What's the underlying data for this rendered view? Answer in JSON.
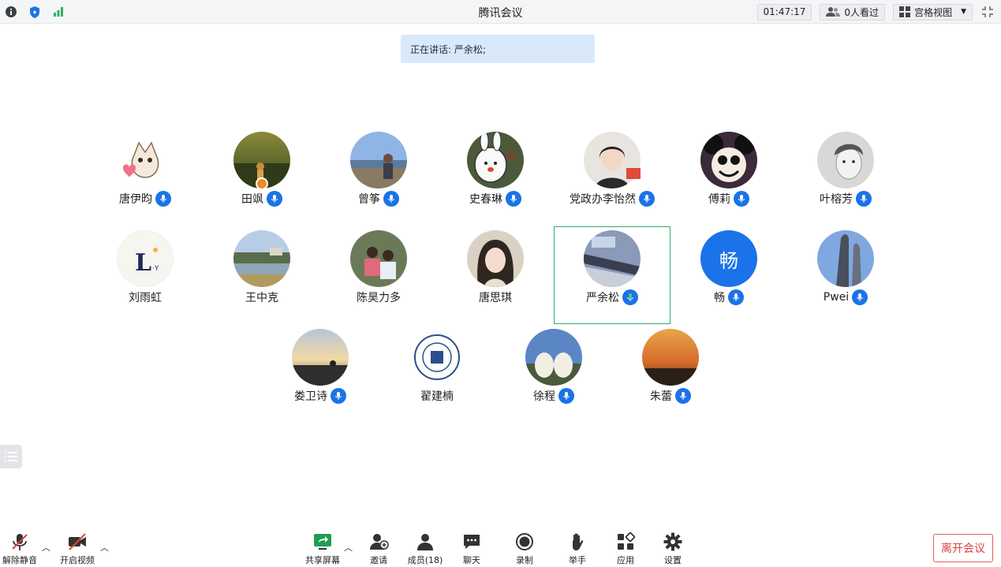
{
  "titlebar": {
    "title": "腾讯会议",
    "timer": "01:47:17",
    "viewers": "0人看过",
    "view_mode": "宫格视图"
  },
  "speaking_banner": "正在讲话: 严余松;",
  "participants": [
    {
      "name": "唐伊昀",
      "mic_icon": "mic-icon"
    },
    {
      "name": "田飒",
      "mic_icon": "mic-icon"
    },
    {
      "name": "曾筝",
      "mic_icon": "mic-icon"
    },
    {
      "name": "史春琳",
      "mic_icon": "mic-icon"
    },
    {
      "name": "党政办李怡然",
      "mic_icon": "mic-icon"
    },
    {
      "name": "傅莉",
      "mic_icon": "mic-icon"
    },
    {
      "name": "叶榕芳",
      "mic_icon": "mic-icon"
    },
    {
      "name": "刘雨虹",
      "mic_icon": "none"
    },
    {
      "name": "王中克",
      "mic_icon": "none"
    },
    {
      "name": "陈昊力多",
      "mic_icon": "none"
    },
    {
      "name": "唐思琪",
      "mic_icon": "none"
    },
    {
      "name": "严余松",
      "mic_icon": "mic-speaking-icon"
    },
    {
      "name": "畅",
      "mic_icon": "mic-icon",
      "avatar_text": "畅"
    },
    {
      "name": "Pwei",
      "mic_icon": "mic-icon"
    },
    {
      "name": "娄卫诗",
      "mic_icon": "mic-icon"
    },
    {
      "name": "翟建楠",
      "mic_icon": "none"
    },
    {
      "name": "徐程",
      "mic_icon": "mic-icon"
    },
    {
      "name": "朱蕾",
      "mic_icon": "mic-icon"
    }
  ],
  "toolbar": {
    "unmute": "解除静音",
    "start_video": "开启视频",
    "share_screen": "共享屏幕",
    "invite": "邀请",
    "members": "成员(18)",
    "chat": "聊天",
    "record": "录制",
    "raise_hand": "举手",
    "apps": "应用",
    "settings": "设置",
    "leave": "离开会议"
  },
  "colors": {
    "accent_blue": "#1a73e8",
    "speaking_green": "#2fae6b",
    "leave_red": "#e04040",
    "banner_bg": "#d9e8fb"
  }
}
